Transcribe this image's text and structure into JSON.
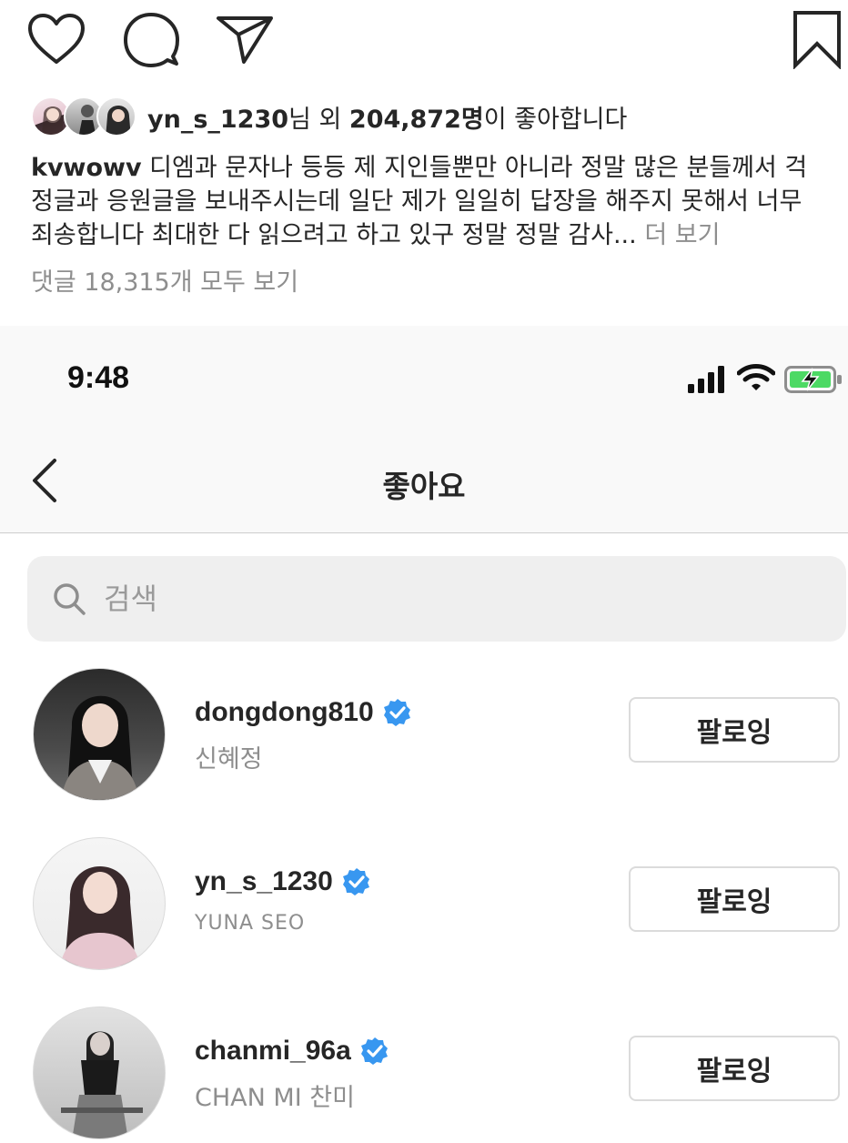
{
  "post": {
    "actions": {
      "like_icon": "heart-icon",
      "comment_icon": "comment-icon",
      "share_icon": "send-icon",
      "save_icon": "bookmark-icon"
    },
    "likes": {
      "username": "yn_s_1230",
      "suffix_1": "님 외 ",
      "count": "204,872명",
      "suffix_2": "이 좋아합니다"
    },
    "caption": {
      "username": "kvwowv",
      "text": " 디엠과 문자나 등등 제 지인들뿐만 아니라 정말 많은 분들께서 걱정글과 응원글을 보내주시는데 일단 제가 일일히 답장을 해주지 못해서 너무 죄송합니다 최대한 다 읽으려고 하고 있구 정말 정말 감사...",
      "more": " 더 보기"
    },
    "comments_link": "댓글 18,315개 모두 보기"
  },
  "status_bar": {
    "time": "9:48"
  },
  "nav": {
    "title": "좋아요"
  },
  "search": {
    "placeholder": "검색"
  },
  "likers": [
    {
      "username": "dongdong810",
      "verified": true,
      "full_name": "신혜정",
      "button": "팔로잉"
    },
    {
      "username": "yn_s_1230",
      "verified": true,
      "full_name": "YUNA SEO",
      "button": "팔로잉"
    },
    {
      "username": "chanmi_96a",
      "verified": true,
      "full_name": "CHAN MI 찬미",
      "button": "팔로잉"
    }
  ],
  "colors": {
    "verified": "#3897f0",
    "muted": "#8e8e8e",
    "battery": "#4cd964"
  }
}
